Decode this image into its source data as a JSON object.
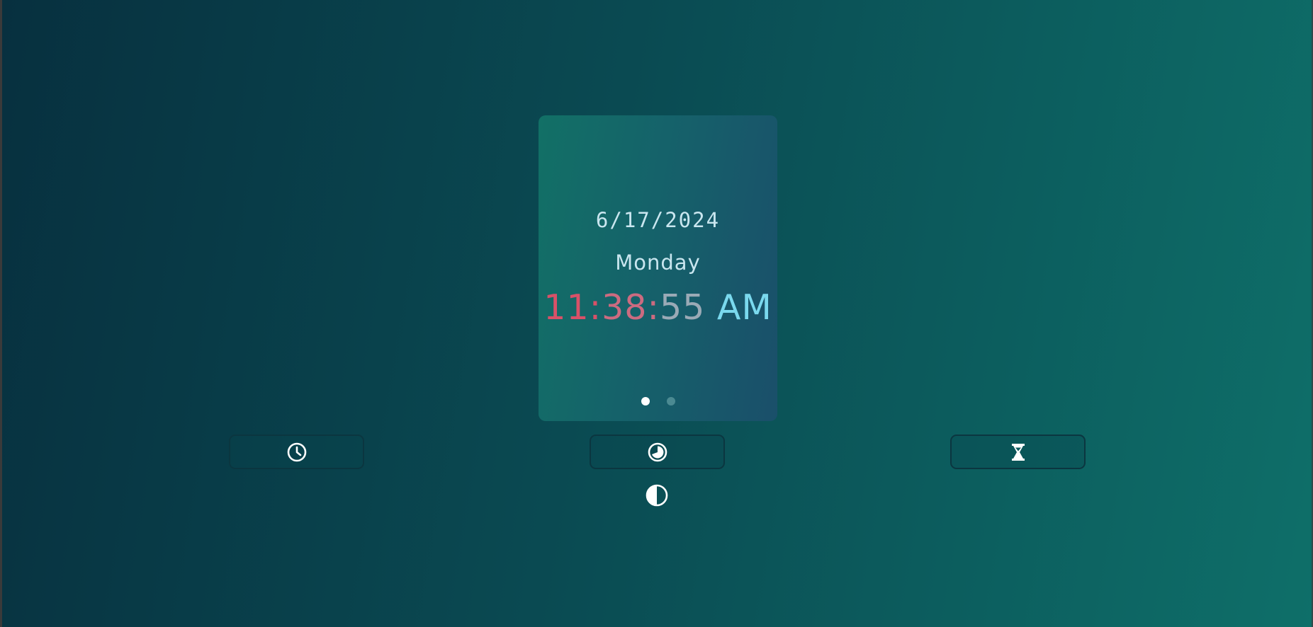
{
  "clock": {
    "date": "6/17/2024",
    "weekday": "Monday",
    "time": {
      "hours": "11:",
      "minutes": "38:",
      "seconds": "55",
      "period": " AM"
    }
  },
  "carousel": {
    "slides": 2,
    "active_index": 0
  },
  "modes": [
    {
      "name": "clock",
      "icon": "clock-icon"
    },
    {
      "name": "stopwatch",
      "icon": "stopwatch-icon"
    },
    {
      "name": "timer",
      "icon": "hourglass-icon"
    }
  ],
  "theme_toggle": {
    "icon": "contrast-icon"
  },
  "colors": {
    "hours": "#d85168",
    "minutes": "#cc6b80",
    "seconds": "#9aaab6",
    "period": "#7ad9ee",
    "text": "#c9e6ef"
  }
}
